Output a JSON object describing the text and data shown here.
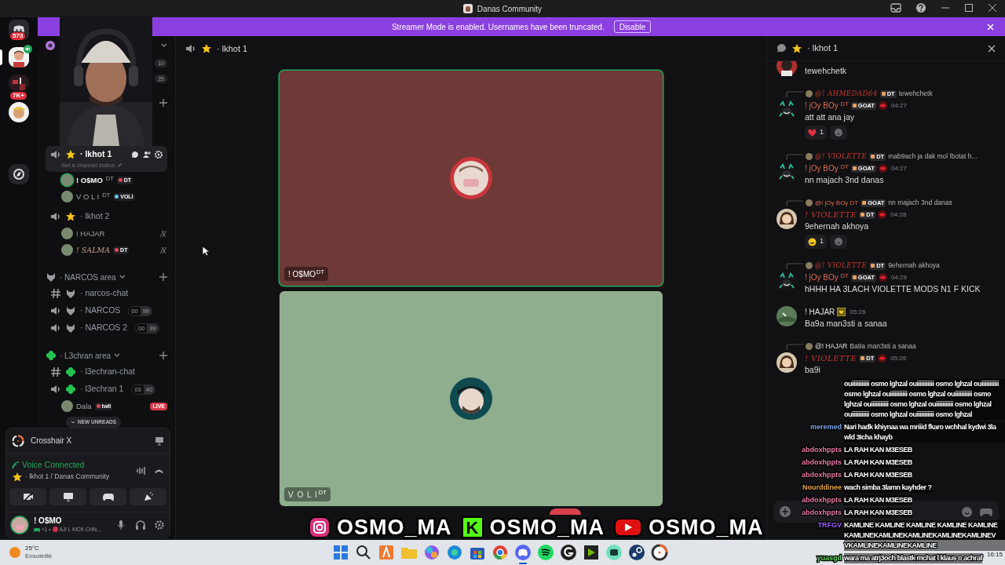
{
  "title_bar": {
    "title": "Danas Community"
  },
  "server_rail": [
    {
      "kind": "home",
      "badge": "573",
      "selected": false
    },
    {
      "kind": "avatar",
      "selected": true
    },
    {
      "kind": "server",
      "badge": "7K+",
      "selected": false
    },
    {
      "kind": "avatar2",
      "selected": false
    },
    {
      "kind": "discover",
      "selected": false
    }
  ],
  "banner": {
    "text": "Streamer Mode is enabled. Usernames have been truncated.",
    "button": "Disable"
  },
  "sidebar": {
    "counters": [
      "10",
      "25"
    ],
    "channels": [
      {
        "kind": "voice",
        "name": "· lkhot 1",
        "selected": true,
        "status": "Set a channel status",
        "children": [
          {
            "name": "! O$MO",
            "sup": "DT",
            "tag": "DT",
            "speaking": true,
            "muted": false
          },
          {
            "name": "V O L I",
            "sup": "DT",
            "tag": "VOLI",
            "speaking": false,
            "muted": false
          }
        ]
      },
      {
        "kind": "voice",
        "name": "· lkhot 2",
        "selected": false,
        "children": [
          {
            "name": "! HAJAR",
            "speaking": false,
            "muted": true
          },
          {
            "name": "! SALMA",
            "tag": "DT",
            "speaking": false,
            "muted": true
          }
        ]
      },
      {
        "kind": "category",
        "name": "· NARCOS area"
      },
      {
        "kind": "text",
        "name": "· narcos-chat",
        "selected": false
      },
      {
        "kind": "voice",
        "name": "· NARCOS",
        "selected": false,
        "counts": [
          "00",
          "99"
        ]
      },
      {
        "kind": "voice",
        "name": "· NARCOS 2",
        "selected": false,
        "counts": [
          "00",
          "99"
        ]
      },
      {
        "kind": "category",
        "name": "· L3chran area"
      },
      {
        "kind": "text",
        "name": "· l3echran-chat",
        "selected": false
      },
      {
        "kind": "voice",
        "name": "· l3echran 1",
        "selected": false,
        "counts": [
          "03",
          "40"
        ],
        "children": [
          {
            "name": "Dala",
            "tag": "twll",
            "live": "LIVE",
            "speaking": false,
            "muted": false
          }
        ]
      }
    ],
    "unreads": "NEW UNREADS"
  },
  "user_panel": {
    "activity": "Crosshair X",
    "voice_status": "Voice Connected",
    "voice_location": "· lkhot 1 / Danas Community",
    "user": {
      "name": "! O$MO",
      "status_count": "+1 •",
      "status": "AJI L KICK CHN..."
    }
  },
  "main": {
    "header": "· lkhot 1",
    "tiles": [
      {
        "name": "! O$MO",
        "sup": "DT",
        "color": "#6e3a37",
        "speaking": true
      },
      {
        "name": "V O L I",
        "sup": "DT",
        "color": "#8fae8e",
        "speaking": false
      }
    ]
  },
  "chat": {
    "header": "· lkhot 1",
    "messages": [
      {
        "kind": "continuation",
        "text": "tewehchetk"
      },
      {
        "kind": "message",
        "reply": {
          "author": "@! AHMEDAD64",
          "tag": "DT",
          "text": "tewehchetk"
        },
        "author": "! jOy BOy",
        "sup": "DT",
        "tag": "GOAT",
        "time": "04:27",
        "text": "att att ana jay",
        "reactions": [
          {
            "kind": "heart",
            "count": "1"
          }
        ]
      },
      {
        "kind": "message",
        "reply": {
          "author": "@! VIOLETTE",
          "tag": "DT",
          "text": "mab9ach ja dak mol lbotat h..."
        },
        "author": "! jOy BOy",
        "sup": "DT",
        "tag": "GOAT",
        "time": "04:27",
        "text": "nn majach 3nd danas"
      },
      {
        "kind": "message",
        "reply": {
          "author": "@! jOy BOy DT",
          "tag": "GOAT",
          "text": "nn majach 3nd danas"
        },
        "author": "! VIOLETTE",
        "tag": "DT",
        "time": "04:28",
        "text": "9ehernah akhoya",
        "reactions": [
          {
            "kind": "laugh",
            "count": "1"
          }
        ]
      },
      {
        "kind": "message",
        "reply": {
          "author": "@! VIOLETTE",
          "tag": "DT",
          "text": "9ehernah akhoya"
        },
        "author": "! jOy BOy",
        "sup": "DT",
        "tag": "GOAT",
        "time": "04:29",
        "text": "hHHH HA 3LACH VIOLETTE MODS N1 F KICK"
      },
      {
        "kind": "message",
        "author": "! HAJAR",
        "time": "05:26",
        "text": "Ba9a man3sti a sanaa"
      },
      {
        "kind": "message",
        "reply": {
          "author": "@! HAJAR",
          "text": "Ba9a man3sti a sanaa"
        },
        "author": "! VIOLETTE",
        "tag": "DT",
        "time": "05:26",
        "text": "ba9i"
      }
    ]
  },
  "stream_overlay": {
    "socials": [
      {
        "kind": "instagram",
        "handle": "OSMO_MA"
      },
      {
        "kind": "kick",
        "mark": "K",
        "handle": "OSMO_MA"
      },
      {
        "kind": "youtube",
        "handle": "OSMO_MA"
      }
    ],
    "chat": [
      {
        "text": "ouiiiiiiiiiii osmo lghzal ouiiiiiiiiiii osmo lghzal ouiiiiiiiiiii osmo lghzal ouiiiiiiiiiii osmo lghzal ouiiiiiiiiiii osmo lghzal ouiiiiiiiiiii osmo lghzal ouiiiiiiiiiii osmo lghzal ouiiiiiiiiiii osmo lghzal ouiiiiiiiiiii osmo lghzal"
      },
      {
        "user": "meremed",
        "color": "#7ea6e8",
        "text": "Nari hadk khiynaa wa mriiid fkaro wchhal kydwi 3la wld 3Icha khayb"
      },
      {
        "user": "abdoxhppts",
        "color": "#e87aa8",
        "text": "LA RAH KAN M3ESEB"
      },
      {
        "user": "abdoxhppts",
        "color": "#e87aa8",
        "text": "LA RAH KAN M3ESEB"
      },
      {
        "user": "abdoxhppts",
        "color": "#e87aa8",
        "text": "LA RAH KAN M3ESEB"
      },
      {
        "user": "Nourddinee",
        "color": "#e8a840",
        "text": "wach simba 3lamn kayhder ?"
      },
      {
        "user": "abdoxhppts",
        "color": "#e87aa8",
        "text": "LA RAH KAN M3ESEB"
      },
      {
        "user": "abdoxhppts",
        "color": "#e87aa8",
        "text": "LA RAH KAN M3ESEB"
      },
      {
        "user": "TRFGV",
        "color": "#9b5cff",
        "text": "KAMLINE KAMLINE KAMLINE KAMLINE KAMLINE KAMLINEKAMLINEKAMLINEKAMLINEKAMLINEV VKAMLINEKAMLINEKAMLINE"
      },
      {
        "user": "yuasgd",
        "color": "#6ad66a",
        "text": "wara ma atrj3och blastk mchat l klaus o achraf"
      }
    ]
  },
  "taskbar": {
    "weather": {
      "temp": "25°C",
      "condition": "Ensoleillé"
    },
    "apps": [
      {
        "kind": "start",
        "active": false
      },
      {
        "kind": "search",
        "active": false
      },
      {
        "kind": "fontbase",
        "active": false
      },
      {
        "kind": "files",
        "active": false
      },
      {
        "kind": "copilot",
        "active": false
      },
      {
        "kind": "edge",
        "active": false
      },
      {
        "kind": "store",
        "active": false
      },
      {
        "kind": "chrome",
        "active": false
      },
      {
        "kind": "discord",
        "active": true
      },
      {
        "kind": "spotify",
        "active": false
      },
      {
        "kind": "ghub",
        "active": false
      },
      {
        "kind": "nvidia",
        "active": false
      },
      {
        "kind": "chatapp",
        "active": false
      },
      {
        "kind": "steam",
        "active": false
      },
      {
        "kind": "crosshair",
        "active": false
      }
    ],
    "time": "16:15"
  }
}
